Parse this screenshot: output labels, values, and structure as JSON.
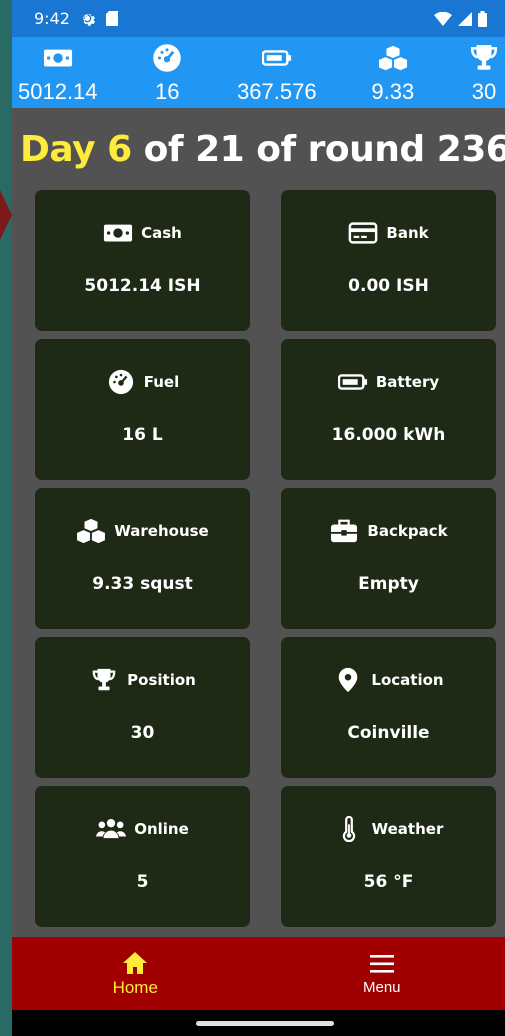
{
  "status_bar": {
    "time": "9:42",
    "icons": [
      "gear-icon",
      "sim-card-icon",
      "wifi-icon",
      "signal-icon",
      "battery-full-icon"
    ]
  },
  "stats": [
    {
      "icon": "cash-icon",
      "value": "5012.14"
    },
    {
      "icon": "fuel-gauge-icon",
      "value": "16"
    },
    {
      "icon": "battery-icon",
      "value": "367.576"
    },
    {
      "icon": "warehouse-boxes-icon",
      "value": "9.33"
    },
    {
      "icon": "trophy-icon",
      "value": "30"
    }
  ],
  "title": {
    "day_prefix": "Day 6",
    "rest": " of 21 of round 236"
  },
  "cards": [
    {
      "icon": "cash-icon",
      "label": "Cash",
      "value": "5012.14 ISH"
    },
    {
      "icon": "credit-card-icon",
      "label": "Bank",
      "value": "0.00 ISH"
    },
    {
      "icon": "fuel-gauge-icon",
      "label": "Fuel",
      "value": "16 L"
    },
    {
      "icon": "battery-icon",
      "label": "Battery",
      "value": "16.000 kWh"
    },
    {
      "icon": "warehouse-boxes-icon",
      "label": "Warehouse",
      "value": "9.33 squst"
    },
    {
      "icon": "briefcase-icon",
      "label": "Backpack",
      "value": "Empty"
    },
    {
      "icon": "trophy-icon",
      "label": "Position",
      "value": "30"
    },
    {
      "icon": "location-pin-icon",
      "label": "Location",
      "value": "Coinville"
    },
    {
      "icon": "users-icon",
      "label": "Online",
      "value": "5"
    },
    {
      "icon": "thermometer-icon",
      "label": "Weather",
      "value": "56 °F"
    }
  ],
  "nav": {
    "home_label": "Home",
    "menu_label": "Menu"
  },
  "colors": {
    "status_bar": "#1976d2",
    "stats_bar": "#2196f3",
    "highlight": "#ffeb3b",
    "card_bg": "#1f2a16",
    "nav_bg": "#a00000",
    "page_bg": "#525252"
  }
}
